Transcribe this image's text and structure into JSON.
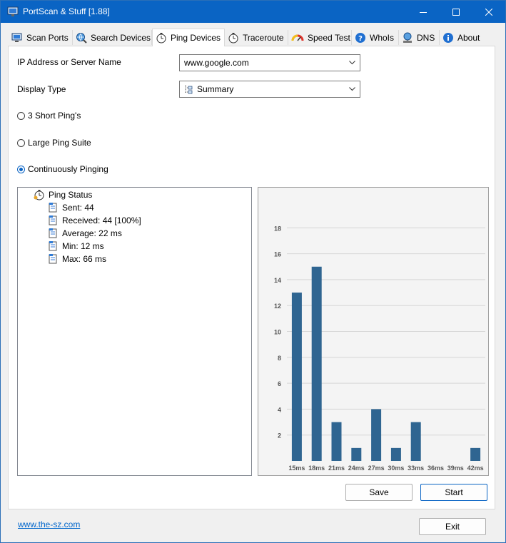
{
  "window": {
    "title": "PortScan & Stuff [1.88]",
    "accent": "#0a64c4"
  },
  "tabs": [
    {
      "label": "Scan Ports",
      "icon": "monitor-icon"
    },
    {
      "label": "Search Devices",
      "icon": "globe-search-icon"
    },
    {
      "label": "Ping Devices",
      "icon": "stopwatch-icon",
      "active": true
    },
    {
      "label": "Traceroute",
      "icon": "stopwatch-route-icon"
    },
    {
      "label": "Speed Test",
      "icon": "speedometer-icon"
    },
    {
      "label": "WhoIs",
      "icon": "help-icon"
    },
    {
      "label": "DNS",
      "icon": "network-icon"
    },
    {
      "label": "About",
      "icon": "info-icon"
    }
  ],
  "form": {
    "address_label": "IP Address or Server Name",
    "address_value": "www.google.com",
    "display_label": "Display Type",
    "display_value": "Summary"
  },
  "radios": {
    "short": "3 Short Ping's",
    "large": "Large Ping Suite",
    "continuous": "Continuously Pinging",
    "selected": "continuous"
  },
  "tree": {
    "root": "Ping Status",
    "items": [
      "Sent: 44",
      "Received: 44 [100%]",
      "Average: 22 ms",
      "Min: 12 ms",
      "Max: 66 ms"
    ]
  },
  "chart_data": {
    "type": "bar",
    "categories": [
      "15ms",
      "18ms",
      "21ms",
      "24ms",
      "27ms",
      "30ms",
      "33ms",
      "36ms",
      "39ms",
      "42ms"
    ],
    "values": [
      13,
      15,
      3,
      1,
      4,
      1,
      3,
      0,
      0,
      1
    ],
    "yticks": [
      2,
      4,
      6,
      8,
      10,
      12,
      14,
      16,
      18
    ],
    "ylim": [
      0,
      20
    ],
    "bar_color": "#2f6591",
    "grid": true
  },
  "buttons": {
    "save": "Save",
    "start": "Start",
    "exit": "Exit"
  },
  "footer": {
    "link": "www.the-sz.com"
  }
}
